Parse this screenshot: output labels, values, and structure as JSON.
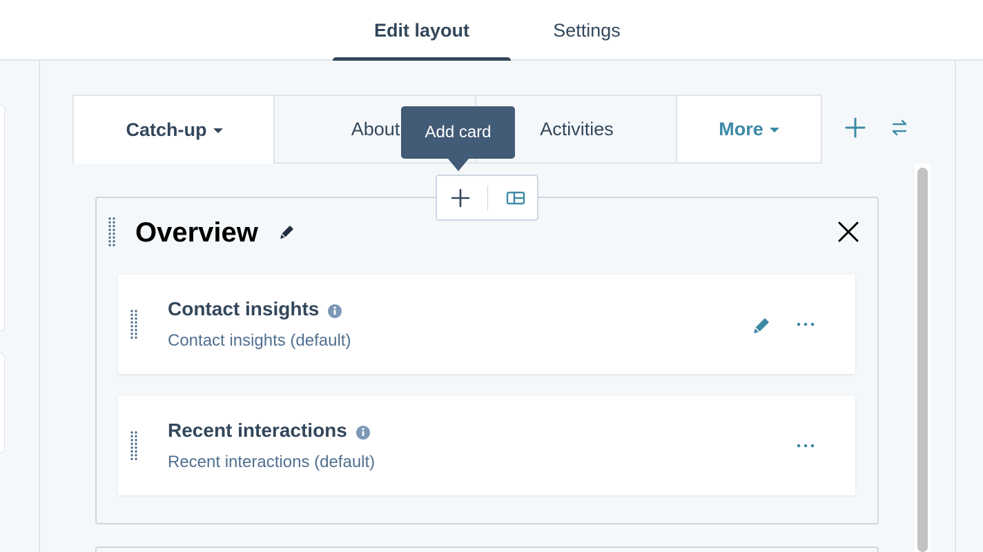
{
  "topnav": {
    "tabs": [
      {
        "label": "Edit layout",
        "active": true
      },
      {
        "label": "Settings",
        "active": false
      }
    ]
  },
  "record_tabs": [
    {
      "label": "Catch-up",
      "active": true,
      "has_dropdown": true
    },
    {
      "label": "About",
      "active": false
    },
    {
      "label": "Activities",
      "active": false
    },
    {
      "label": "More",
      "has_dropdown": true
    }
  ],
  "tab_actions": {
    "add_icon": "plus-icon",
    "reorder_icon": "swap-arrows-icon"
  },
  "tooltip": {
    "text": "Add card"
  },
  "add_toolbar": {
    "add_icon": "plus-icon",
    "layout_icon": "layout-icon"
  },
  "section": {
    "title": "Overview",
    "cards": [
      {
        "title": "Contact insights",
        "subtitle": "Contact insights (default)",
        "editable": true
      },
      {
        "title": "Recent interactions",
        "subtitle": "Recent interactions (default)",
        "editable": false
      }
    ]
  },
  "colors": {
    "text": "#33475b",
    "accent": "#3d8aa5",
    "tooltip_bg": "#425b76",
    "border": "#cbd6e2"
  }
}
